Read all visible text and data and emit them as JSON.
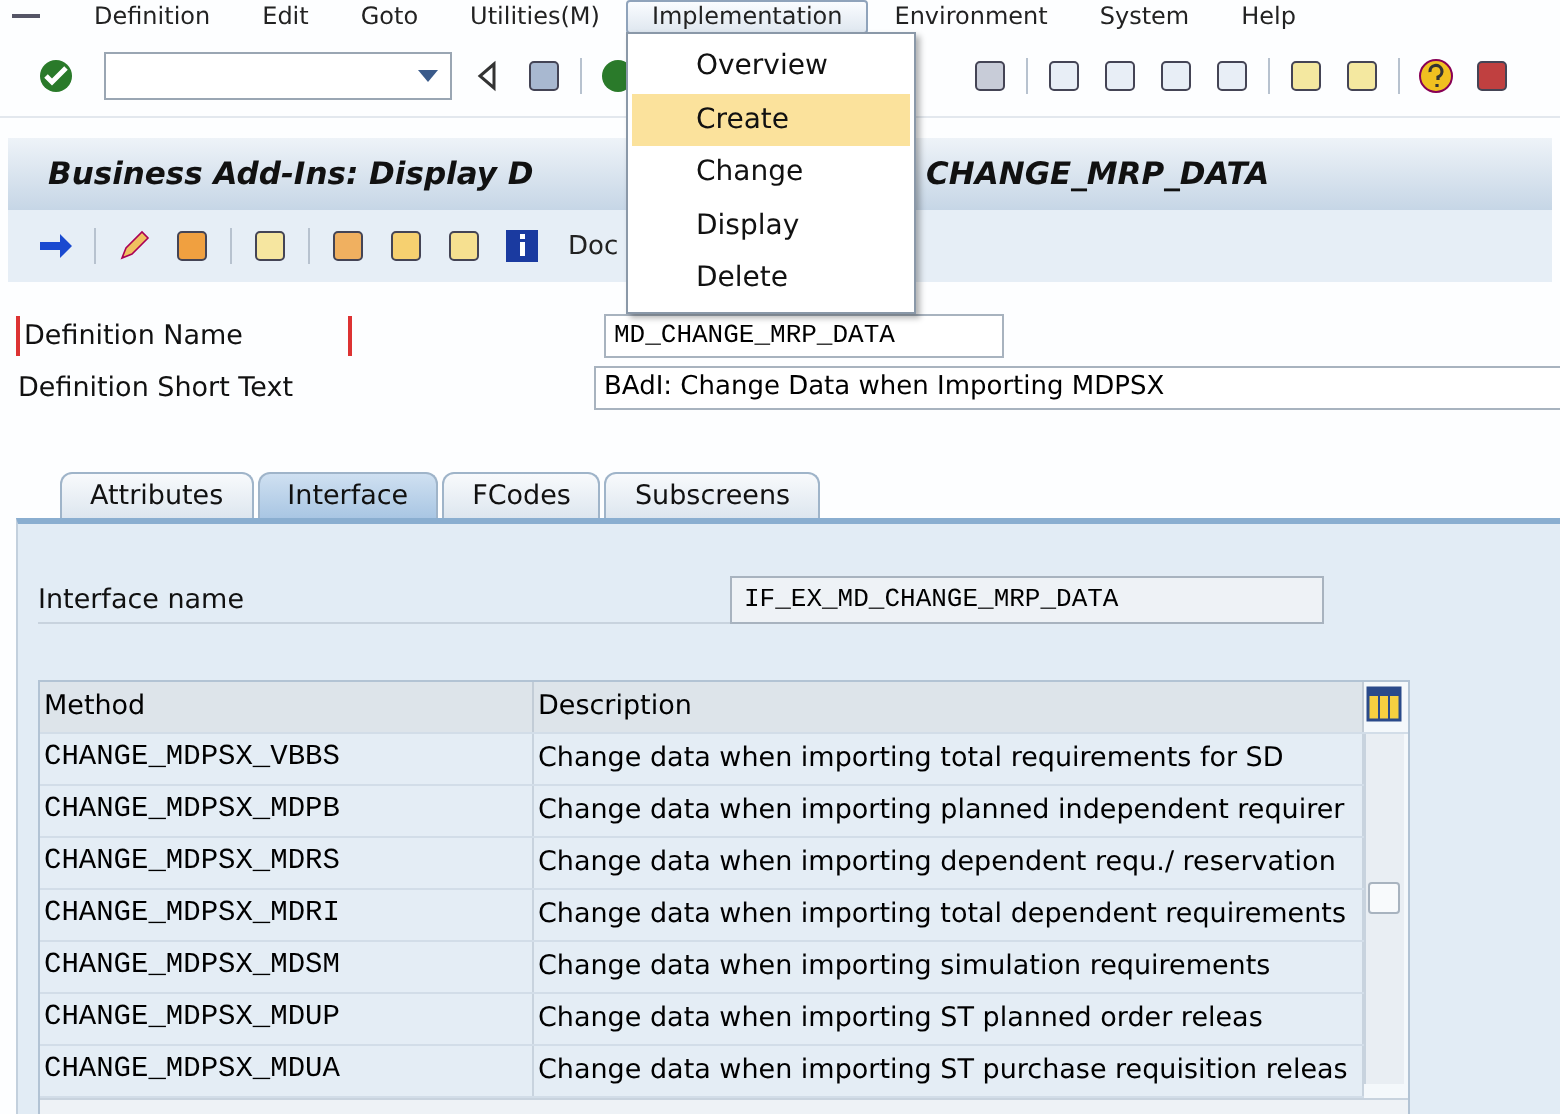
{
  "menu_bar": {
    "items": [
      {
        "label": "Definition",
        "selected": false
      },
      {
        "label": "Edit",
        "selected": false
      },
      {
        "label": "Goto",
        "selected": false
      },
      {
        "label": "Utilities(M)",
        "selected": false
      },
      {
        "label": "Implementation",
        "selected": true
      },
      {
        "label": "Environment",
        "selected": false
      },
      {
        "label": "System",
        "selected": false
      },
      {
        "label": "Help",
        "selected": false
      }
    ]
  },
  "dropdown": {
    "items": [
      {
        "label": "Overview",
        "selected": false
      },
      {
        "label": "Create",
        "selected": true
      },
      {
        "label": "Change",
        "selected": false
      },
      {
        "label": "Display",
        "selected": false
      },
      {
        "label": "Delete",
        "selected": false
      }
    ]
  },
  "title_parts": [
    "Business Add-Ins: Display D",
    "CHANGE_MRP_DATA"
  ],
  "app_toolbar": {
    "text": "Doc"
  },
  "fields": [
    {
      "label": "Definition Name",
      "value": "MD_CHANGE_MRP_DATA",
      "focused": true
    },
    {
      "label": "Definition Short Text",
      "value": "BAdI: Change Data when Importing MDPSX",
      "focused": false
    }
  ],
  "tabs": [
    {
      "label": "Attributes",
      "selected": false
    },
    {
      "label": "Interface",
      "selected": true
    },
    {
      "label": "FCodes",
      "selected": false
    },
    {
      "label": "Subscreens",
      "selected": false
    }
  ],
  "interface": {
    "label": "Interface name",
    "value": "IF_EX_MD_CHANGE_MRP_DATA"
  },
  "table": {
    "columns": [
      "Method",
      "Description"
    ],
    "rows": [
      [
        "CHANGE_MDPSX_VBBS",
        "Change data when importing total requirements for SD"
      ],
      [
        "CHANGE_MDPSX_MDPB",
        "Change data when importing planned independent requirer"
      ],
      [
        "CHANGE_MDPSX_MDRS",
        "Change data when importing dependent requ./ reservation"
      ],
      [
        "CHANGE_MDPSX_MDRI",
        "Change data when importing total dependent requirements"
      ],
      [
        "CHANGE_MDPSX_MDSM",
        "Change data when importing simulation requirements"
      ],
      [
        "CHANGE_MDPSX_MDUP",
        "Change data when importing ST planned order releas"
      ],
      [
        "CHANGE_MDPSX_MDUA",
        "Change data when importing ST purchase requisition releas"
      ]
    ]
  }
}
